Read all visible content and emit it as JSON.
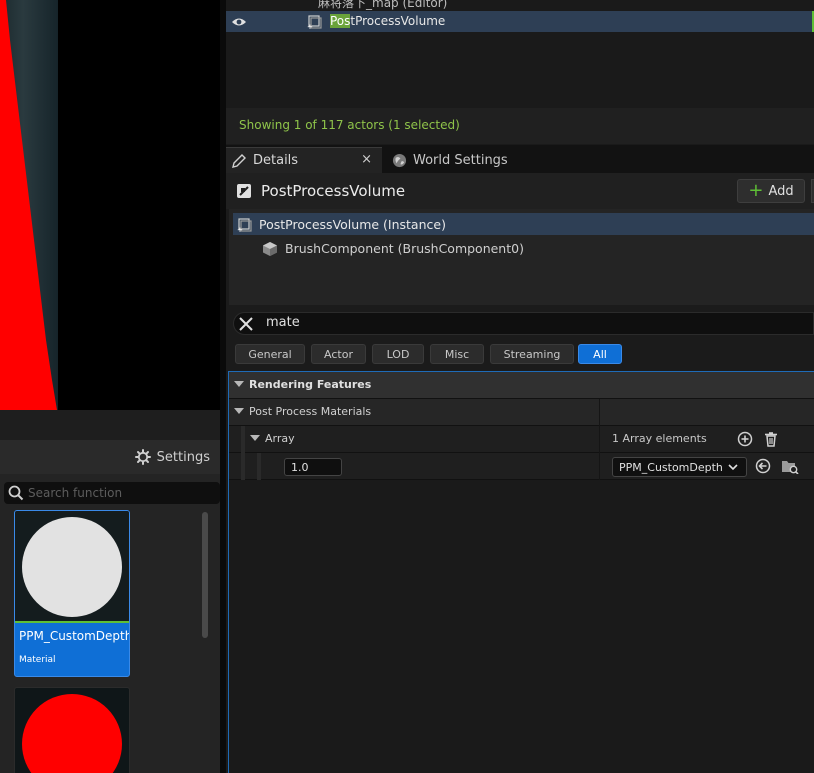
{
  "outliner": {
    "parent_label": "麻将落下_map (Editor)",
    "selected_actor": {
      "highlight": "Pos",
      "rest": "tProcessVolume"
    },
    "status": "Showing 1 of 117 actors (1 selected)"
  },
  "tabs": {
    "details": "Details",
    "close": "×",
    "world_settings": "World Settings"
  },
  "details": {
    "title": "PostProcessVolume",
    "add_label": "Add",
    "components": [
      {
        "label": "PostProcessVolume (Instance)",
        "icon": "volume-icon"
      },
      {
        "label": "BrushComponent (BrushComponent0)",
        "icon": "cube-icon"
      }
    ],
    "search_value": "mate",
    "filters": [
      "General",
      "Actor",
      "LOD",
      "Misc",
      "Streaming",
      "All"
    ],
    "selected_filter": "All",
    "category": "Rendering Features",
    "property": "Post Process Materials",
    "array_label": "Array",
    "array_count": "1 Array elements",
    "element_weight": "1.0",
    "element_material": "PPM_CustomDepth"
  },
  "palette": {
    "settings_label": "Settings",
    "search_placeholder": "Search function",
    "items": [
      {
        "name": "PPM_CustomDepth",
        "type": "Material"
      }
    ]
  },
  "colors": {
    "accent": "#0f6fd6",
    "selection": "#2e3f55",
    "status_green": "#8fc44a",
    "add_green": "#5fbf36"
  }
}
